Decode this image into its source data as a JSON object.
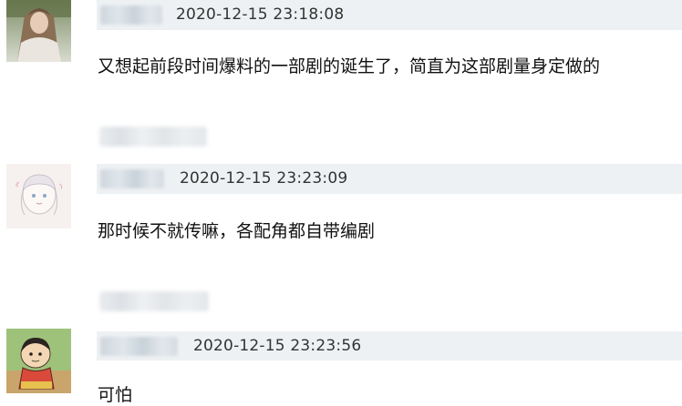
{
  "comments": [
    {
      "avatar": "girl-portrait-avatar",
      "timestamp": "2020-12-15 23:18:08",
      "text": "又想起前段时间爆料的一部剧的诞生了，简直为这部剧量身定做的"
    },
    {
      "avatar": "anime-sketch-avatar",
      "timestamp": "2020-12-15 23:23:09",
      "text": "那时候不就传嘛，各配角都自带编剧"
    },
    {
      "avatar": "cartoon-boy-avatar",
      "timestamp": "2020-12-15 23:23:56",
      "text": "可怕"
    }
  ],
  "colors": {
    "meta_bar": "#eef1f3",
    "text": "#111111",
    "timestamp": "#333333"
  }
}
